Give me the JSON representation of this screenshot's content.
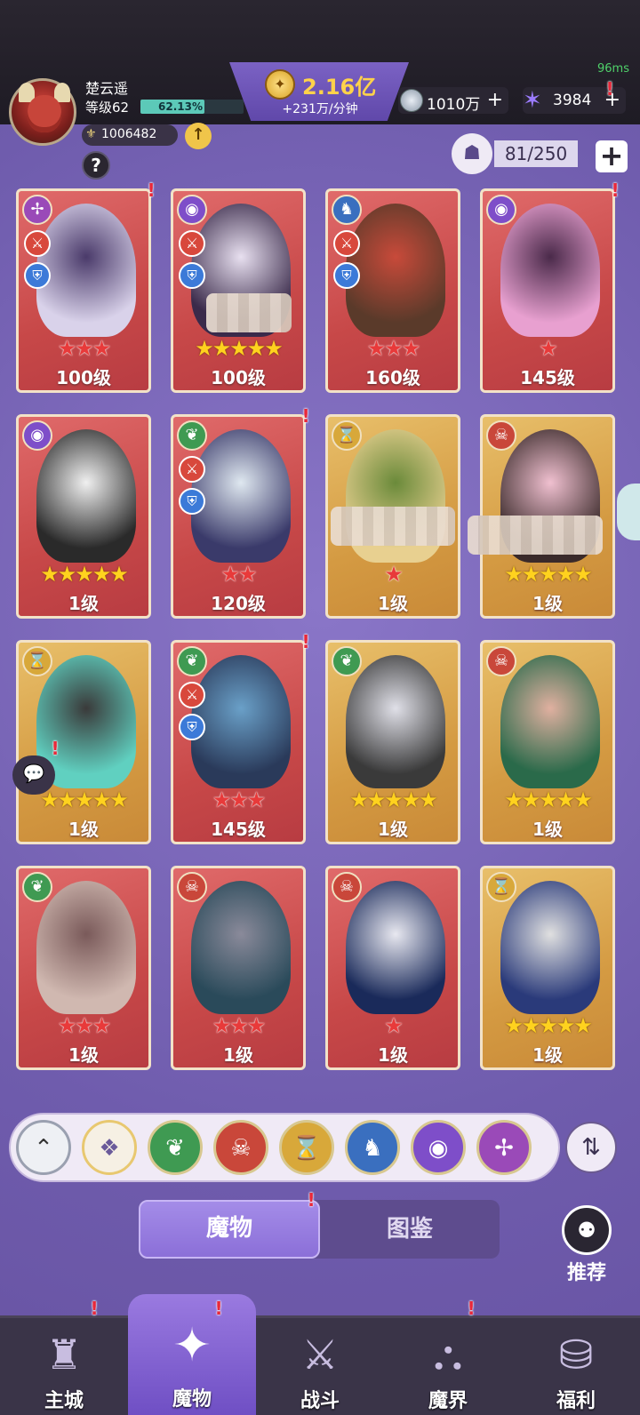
{
  "status": {
    "ping": "96ms"
  },
  "player": {
    "name": "楚云遥",
    "level_label": "等级62",
    "exp_percent_text": "62.13%",
    "exp_fraction": 0.6213,
    "power": "1006482",
    "up_icon": "arrow-up-icon",
    "help_icon": "question-icon"
  },
  "currency": {
    "gold": "2.16亿",
    "gold_rate": "+231万/分钟",
    "silver": "1010万",
    "gems": "3984"
  },
  "capacity": {
    "text": "81/250"
  },
  "monsters": [
    {
      "level": "100级",
      "stars": 3,
      "star_color": "red",
      "bg": "red",
      "element": "wind",
      "alert": true
    },
    {
      "level": "100级",
      "stars": 5,
      "star_color": "gold",
      "bg": "red",
      "element": "eye",
      "alert": false
    },
    {
      "level": "160级",
      "stars": 3,
      "star_color": "red",
      "bg": "red",
      "element": "dragon",
      "alert": false
    },
    {
      "level": "145级",
      "stars": 1,
      "star_color": "red",
      "bg": "red",
      "element": "eye",
      "alert": true
    },
    {
      "level": "1级",
      "stars": 5,
      "star_color": "gold",
      "bg": "red",
      "element": "eye",
      "alert": false
    },
    {
      "level": "120级",
      "stars": 2,
      "star_color": "red",
      "bg": "red",
      "element": "leaf",
      "alert": true
    },
    {
      "level": "1级",
      "stars": 1,
      "star_color": "red",
      "bg": "gold",
      "element": "hourglass",
      "alert": false
    },
    {
      "level": "1级",
      "stars": 5,
      "star_color": "gold",
      "bg": "gold",
      "element": "demon",
      "alert": false
    },
    {
      "level": "1级",
      "stars": 5,
      "star_color": "gold",
      "bg": "gold",
      "element": "hourglass",
      "alert": false
    },
    {
      "level": "145级",
      "stars": 3,
      "star_color": "red",
      "bg": "red",
      "element": "leaf",
      "alert": true
    },
    {
      "level": "1级",
      "stars": 5,
      "star_color": "gold",
      "bg": "gold",
      "element": "leaf",
      "alert": false
    },
    {
      "level": "1级",
      "stars": 5,
      "star_color": "gold",
      "bg": "gold",
      "element": "demon",
      "alert": false
    },
    {
      "level": "1级",
      "stars": 3,
      "star_color": "red",
      "bg": "red",
      "element": "leaf",
      "alert": false
    },
    {
      "level": "1级",
      "stars": 3,
      "star_color": "red",
      "bg": "red",
      "element": "demon",
      "alert": false
    },
    {
      "level": "1级",
      "stars": 1,
      "star_color": "red",
      "bg": "red",
      "element": "demon",
      "alert": false
    },
    {
      "level": "1级",
      "stars": 5,
      "star_color": "gold",
      "bg": "gold",
      "element": "hourglass",
      "alert": false
    }
  ],
  "filters": [
    "collapse",
    "all",
    "leaf",
    "demon",
    "hourglass",
    "dragon",
    "eye",
    "wind"
  ],
  "tabs": {
    "active": "魔物",
    "inactive": "图鉴"
  },
  "recommend_label": "推荐",
  "nav": [
    {
      "label": "主城",
      "icon": "castle-icon"
    },
    {
      "label": "魔物",
      "icon": "monster-flame-icon"
    },
    {
      "label": "战斗",
      "icon": "sword-shield-icon"
    },
    {
      "label": "魔界",
      "icon": "demon-realm-icon"
    },
    {
      "label": "福利",
      "icon": "chest-icon"
    }
  ],
  "colors": {
    "element_leaf": "#3f9a52",
    "element_demon": "#c9473a",
    "element_hourglass": "#d8a83a",
    "element_dragon": "#3a6fbf",
    "element_eye": "#7e4ec9",
    "element_wind": "#9a4ab8"
  }
}
